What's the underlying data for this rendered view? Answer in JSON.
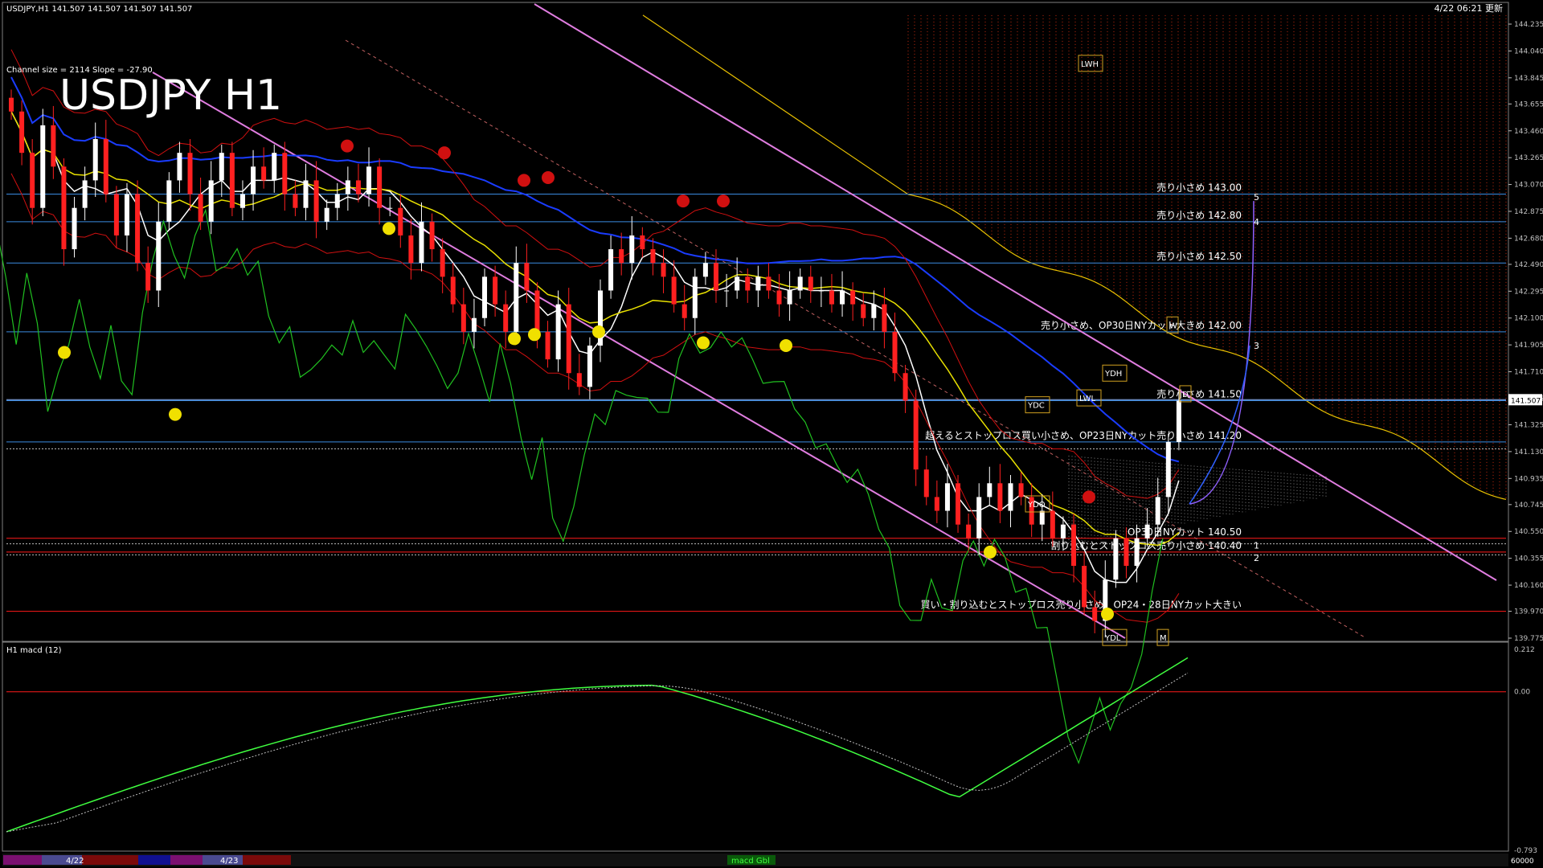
{
  "window": {
    "header_text": "USDJPY,H1  141.507 141.507 141.507 141.507",
    "timestamp": "4/22 06:21 更新"
  },
  "chart": {
    "big_title": "USDJPY H1",
    "channel_info": "Channel size = 2114  Slope = -27.90",
    "current_price": "141.507"
  },
  "colors": {
    "bg": "#000000",
    "axis": "#c0c0c0",
    "level_line": "#3b8be0",
    "red_line": "#ff1a1a",
    "channel": "#e07de0",
    "bull_candle": "#ffffff",
    "bear_candle": "#ff2020",
    "sma_white": "#ffffff",
    "sma_yellow": "#e8e000",
    "sma_blue": "#1a3cff",
    "chikou": "#20c020",
    "bollinger": "#d01010",
    "kumo": "#e03010",
    "macd_line": "#40ff40",
    "macd_signal": "#c0c0c0"
  },
  "price_ticks": [
    "144.235",
    "144.040",
    "143.845",
    "143.655",
    "143.460",
    "143.265",
    "143.070",
    "142.875",
    "142.680",
    "142.490",
    "142.295",
    "142.100",
    "141.905",
    "141.710",
    "141.515",
    "141.325",
    "141.130",
    "140.935",
    "140.745",
    "140.550",
    "140.355",
    "140.160",
    "139.970",
    "139.775"
  ],
  "macd_ticks": [
    "0.212",
    "0.00",
    "-0.793"
  ],
  "macd_title": "H1  macd (12)",
  "bottom_bar": {
    "labels": [
      "4/22",
      "4/23"
    ],
    "center_label": "macd Gbl",
    "right_label": "60000"
  },
  "levels": [
    {
      "price": 143.0,
      "text": "売り小さめ 143.00",
      "color": "blue"
    },
    {
      "price": 142.8,
      "text": "売り小さめ 142.80",
      "color": "blue"
    },
    {
      "price": 142.5,
      "text": "売り小さめ 142.50",
      "color": "blue"
    },
    {
      "price": 142.0,
      "text": "売り小さめ、OP30日NYカット大きめ 142.00",
      "color": "blue"
    },
    {
      "price": 141.5,
      "text": "売り小さめ 141.50",
      "color": "blue"
    },
    {
      "price": 141.2,
      "text": "超えるとストップロス買い小さめ、OP23日NYカット売り小さめ 141.20",
      "color": "blue"
    },
    {
      "price": 140.5,
      "text": "OP30日NYカット 140.50",
      "color": "red"
    },
    {
      "price": 140.4,
      "text": "割り込むとストップロス売り小さめ 140.40",
      "color": "red"
    },
    {
      "price": 139.97,
      "text": "買い・割り込むとストップロス売り小さめ、OP24・28日NYカット大きい",
      "color": "red"
    }
  ],
  "box_labels": [
    "LWH",
    "YDH",
    "YDC",
    "LWL",
    "YDO",
    "YDL",
    "W",
    "M",
    "D"
  ],
  "projection_labels": [
    "1",
    "2",
    "3",
    "4",
    "5"
  ],
  "chart_data": {
    "type": "candlestick",
    "symbol": "USDJPY",
    "timeframe": "H1",
    "ylim": [
      139.775,
      144.235
    ],
    "last_price": 141.507,
    "horizontal_levels": [
      143.0,
      142.8,
      142.5,
      142.0,
      141.5,
      141.2,
      140.5,
      140.4,
      139.97
    ],
    "close_path": [
      143.6,
      143.3,
      142.9,
      143.5,
      143.2,
      142.6,
      142.9,
      143.1,
      143.4,
      143.0,
      142.7,
      143.0,
      142.5,
      142.3,
      142.8,
      143.1,
      143.3,
      143.0,
      142.8,
      143.1,
      143.3,
      142.9,
      143.0,
      143.2,
      143.1,
      143.3,
      143.0,
      142.9,
      143.1,
      142.8,
      142.9,
      143.0,
      143.1,
      143.0,
      143.2,
      142.9,
      142.9,
      142.7,
      142.5,
      142.8,
      142.6,
      142.4,
      142.2,
      142.0,
      142.1,
      142.4,
      142.2,
      142.0,
      142.5,
      142.3,
      142.0,
      141.8,
      142.2,
      141.7,
      141.6,
      141.9,
      142.3,
      142.6,
      142.5,
      142.7,
      142.6,
      142.5,
      142.4,
      142.2,
      142.1,
      142.4,
      142.5,
      142.3,
      142.3,
      142.4,
      142.3,
      142.4,
      142.3,
      142.2,
      142.3,
      142.4,
      142.3,
      142.3,
      142.2,
      142.3,
      142.2,
      142.1,
      142.2,
      142.0,
      141.7,
      141.5,
      141.0,
      140.8,
      140.7,
      140.9,
      140.6,
      140.5,
      140.8,
      140.9,
      140.7,
      140.9,
      140.8,
      140.6,
      140.7,
      140.5,
      140.6,
      140.3,
      140.0,
      139.9,
      140.2,
      140.5,
      140.3,
      140.5,
      140.6,
      140.8,
      141.2,
      141.5
    ]
  }
}
